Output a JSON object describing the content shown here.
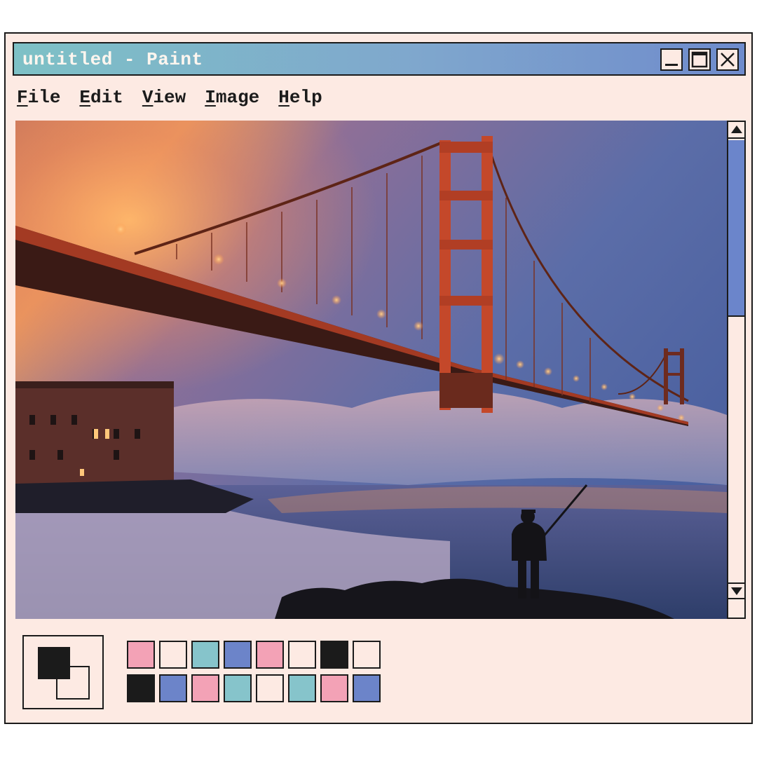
{
  "window": {
    "title": "untitled - Paint"
  },
  "menu": [
    {
      "mnemonic": "F",
      "rest": "ile"
    },
    {
      "mnemonic": "E",
      "rest": "dit"
    },
    {
      "mnemonic": "V",
      "rest": "iew"
    },
    {
      "mnemonic": "I",
      "rest": "mage"
    },
    {
      "mnemonic": "H",
      "rest": "elp"
    }
  ],
  "icons": {
    "minimize": "minimize-icon",
    "maximize": "maximize-icon",
    "close": "close-icon",
    "scroll_up": "arrow-up-icon",
    "scroll_down": "arrow-down-icon"
  },
  "scrollbar": {
    "thumb_start_fraction": 0.0,
    "thumb_size_fraction": 0.4
  },
  "colors": {
    "foreground": "#1b1b1b",
    "background": "#fdeae3",
    "title_gradient": [
      "#7ec1c6",
      "#7fa7cd",
      "#6f8bcc"
    ]
  },
  "palette": [
    "#f3a2b6",
    "#fdeae3",
    "#86c4cb",
    "#6c84c9",
    "#f3a2b6",
    "#fdeae3",
    "#1b1b1b",
    "#fdeae3",
    "#1b1b1b",
    "#6c84c9",
    "#f3a2b6",
    "#86c4cb",
    "#fdeae3",
    "#86c4cb",
    "#f3a2b6",
    "#6c84c9"
  ]
}
